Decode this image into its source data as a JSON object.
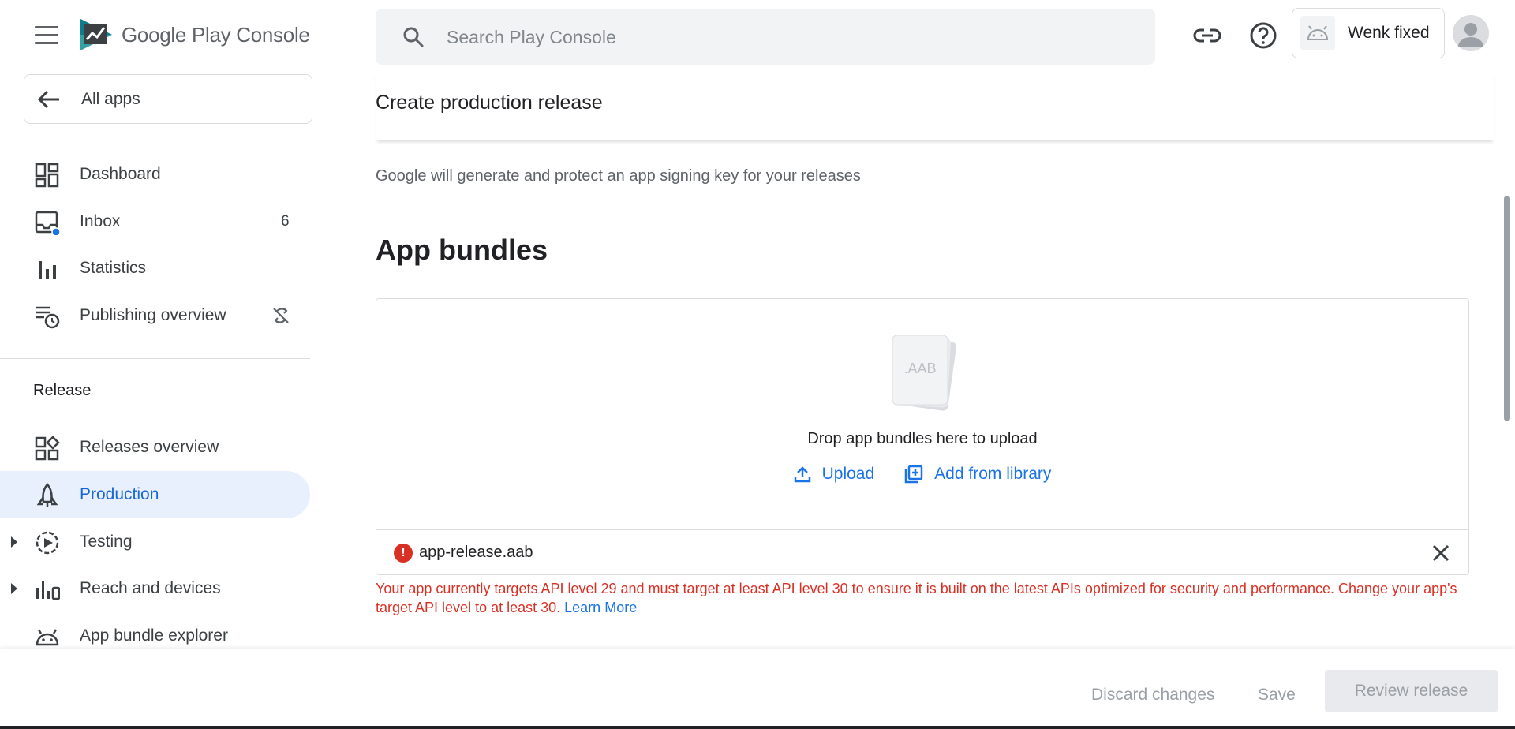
{
  "header": {
    "logo_google_play": "Google Play",
    "logo_console": "Console",
    "search_placeholder": "Search Play Console",
    "account_name": "Wenk fixed"
  },
  "sidebar": {
    "all_apps": "All apps",
    "items": [
      {
        "label": "Dashboard"
      },
      {
        "label": "Inbox",
        "count": "6"
      },
      {
        "label": "Statistics"
      },
      {
        "label": "Publishing overview"
      }
    ],
    "section_release": "Release",
    "release_items": [
      {
        "label": "Releases overview"
      },
      {
        "label": "Production"
      },
      {
        "label": "Testing"
      },
      {
        "label": "Reach and devices"
      },
      {
        "label": "App bundle explorer"
      }
    ]
  },
  "main": {
    "page_title": "Create production release",
    "signing_note": "Google will generate and protect an app signing key for your releases",
    "section_title": "App bundles",
    "aab_label": ".AAB",
    "drop_text": "Drop app bundles here to upload",
    "upload_label": "Upload",
    "library_label": "Add from library",
    "file_name": "app-release.aab",
    "error_text": "Your app currently targets API level 29 and must target at least API level 30 to ensure it is built on the latest APIs optimized for security and performance. Change your app's target API level to at least 30.",
    "learn_more": "Learn More"
  },
  "footer": {
    "discard": "Discard changes",
    "save": "Save",
    "review": "Review release"
  },
  "colors": {
    "accent": "#1a73e8",
    "active_bg": "#e8f0fe",
    "error": "#d93025",
    "success": "#1e8e3e"
  }
}
